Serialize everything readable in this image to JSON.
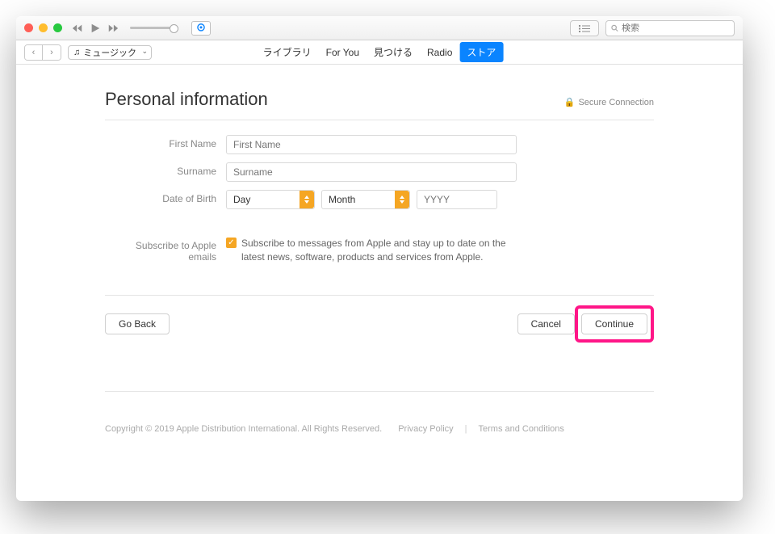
{
  "search": {
    "placeholder": "検索"
  },
  "media_selector": {
    "label": "ミュージック"
  },
  "tabs": {
    "library": "ライブラリ",
    "for_you": "For You",
    "browse": "見つける",
    "radio": "Radio",
    "store": "ストア"
  },
  "page": {
    "title": "Personal information",
    "secure": "Secure Connection"
  },
  "form": {
    "first_name_label": "First Name",
    "first_name_placeholder": "First Name",
    "surname_label": "Surname",
    "surname_placeholder": "Surname",
    "dob_label": "Date of Birth",
    "day_label": "Day",
    "month_label": "Month",
    "year_placeholder": "YYYY",
    "subscribe_label": "Subscribe to Apple emails",
    "subscribe_text": "Subscribe to messages from Apple and stay up to date on the latest news, software, products and services from Apple."
  },
  "buttons": {
    "go_back": "Go Back",
    "cancel": "Cancel",
    "continue": "Continue"
  },
  "footer": {
    "copyright": "Copyright © 2019 Apple Distribution International. All Rights Reserved.",
    "privacy": "Privacy Policy",
    "terms": "Terms and Conditions"
  }
}
